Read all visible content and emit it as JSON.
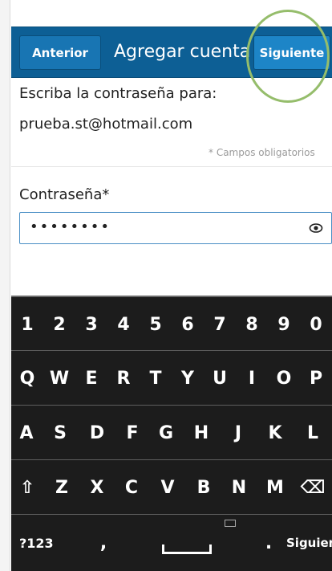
{
  "header": {
    "back_label": "Anterior",
    "title": "Agregar cuenta",
    "next_label": "Siguiente"
  },
  "form": {
    "prompt": "Escriba la contraseña para:",
    "email": "prueba.st@hotmail.com",
    "required_note": "* Campos obligatorios",
    "password_label": "Contraseña*",
    "password_value": "••••••••"
  },
  "keyboard": {
    "row1": [
      "1",
      "2",
      "3",
      "4",
      "5",
      "6",
      "7",
      "8",
      "9",
      "0"
    ],
    "row2": [
      "Q",
      "W",
      "E",
      "R",
      "T",
      "Y",
      "U",
      "I",
      "O",
      "P"
    ],
    "row3": [
      "A",
      "S",
      "D",
      "F",
      "G",
      "H",
      "J",
      "K",
      "L"
    ],
    "row4": [
      "⇧",
      "Z",
      "X",
      "C",
      "V",
      "B",
      "N",
      "M",
      "⌫"
    ],
    "sym_label": "?123",
    "comma": ",",
    "dot": ".",
    "enter_label": "Siguiente"
  },
  "colors": {
    "titlebar": "#0d5f95",
    "accent_field": "#4a8fc5",
    "highlight": "#95bd6b",
    "keyboard_bg": "#1c1c1c"
  }
}
